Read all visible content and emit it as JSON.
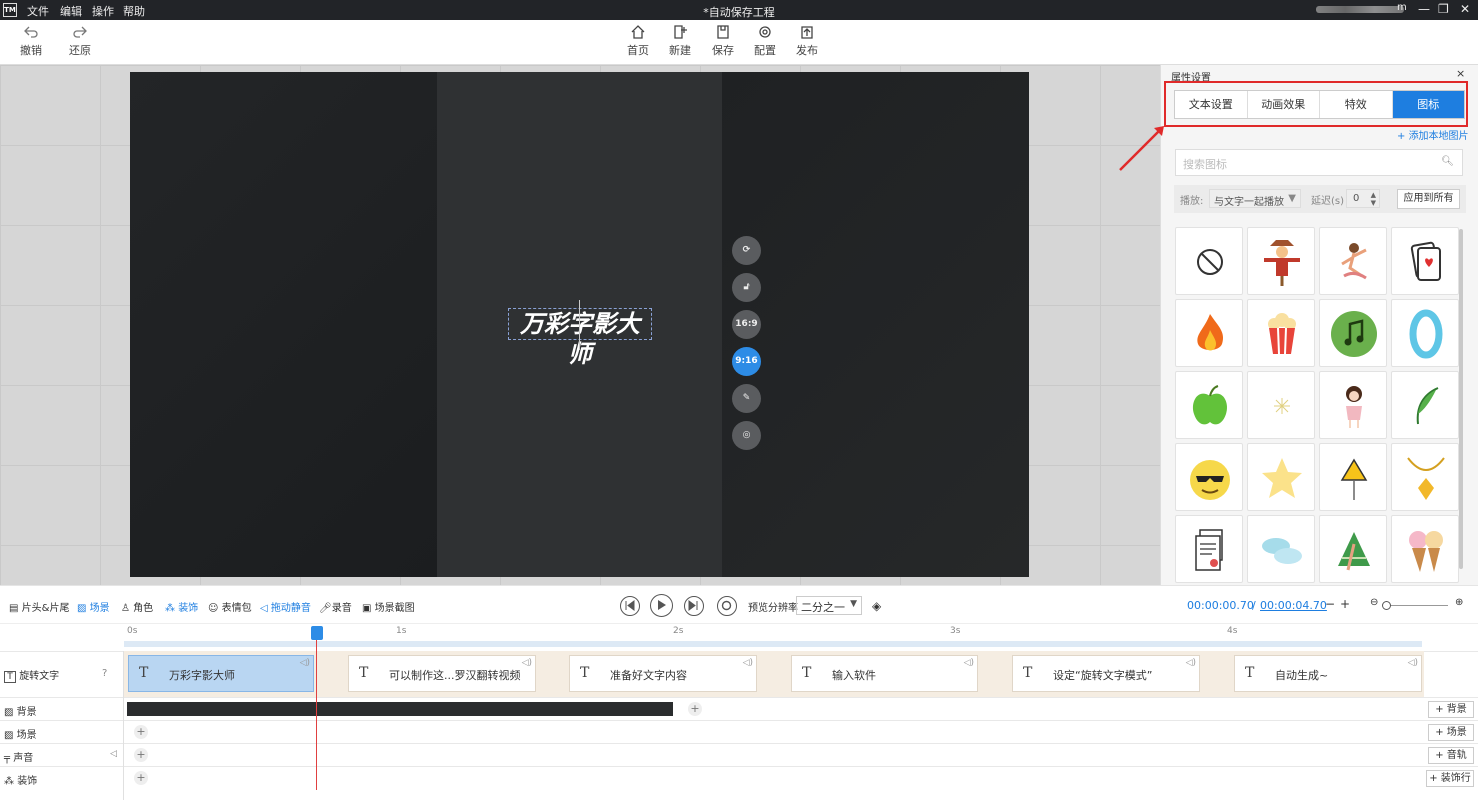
{
  "titlebar": {
    "logo": "TM",
    "menus": [
      "文件",
      "编辑",
      "操作",
      "帮助"
    ],
    "title": "*自动保存工程",
    "user": "m",
    "min": "—",
    "max": "❐",
    "close": "✕"
  },
  "toolbar": {
    "undo": "撤销",
    "redo": "还原",
    "home": "首页",
    "new": "新建",
    "save": "保存",
    "config": "配置",
    "publish": "发布"
  },
  "canvas": {
    "main_text": "万彩字影大师",
    "ratio_169": "16:9",
    "ratio_916": "9:16"
  },
  "panel": {
    "title": "属性设置",
    "close": "×",
    "tabs": [
      "文本设置",
      "动画效果",
      "特效",
      "图标"
    ],
    "active_tab": "图标",
    "add_local": "添加本地图片",
    "search_placeholder": "搜索图标",
    "play_label": "播放:",
    "play_value": "与文字一起播放",
    "delay_label": "延迟(s)",
    "delay_value": "0",
    "apply_all": "应用到所有",
    "icons": [
      "no-entry-icon",
      "scarecrow-icon",
      "dancing-girl-icon",
      "playing-cards-icon",
      "fire-icon",
      "popcorn-icon",
      "music-note-icon",
      "blue-ring-icon",
      "green-apple-icon",
      "sparkle-icon",
      "girl-figure-icon",
      "leaf-icon",
      "cool-emoji-icon",
      "star-icon",
      "warning-sign-icon",
      "necklace-icon",
      "document-icon",
      "macaron-icon",
      "zongzi-icon",
      "ice-cream-icon"
    ]
  },
  "controls": {
    "items": [
      "片头&片尾",
      "场景",
      "角色",
      "装饰",
      "表情包",
      "拖动静音",
      "录音",
      "场景截图"
    ],
    "preview_label": "预览分辨率",
    "preview_value": "二分之一",
    "time_current": "00:00:00.70",
    "time_sep": "/",
    "time_total": "00:00:04.70"
  },
  "ruler": {
    "ticks": [
      "0s",
      "1s",
      "2s",
      "3s",
      "4s"
    ]
  },
  "tracks": {
    "text": "旋转文字",
    "bg": "背景",
    "scene": "场景",
    "sound": "声音",
    "deco": "装饰",
    "add_bg": "+ 背景",
    "add_scene": "+ 场景",
    "add_sound": "+ 音轨",
    "add_deco": "+ 装饰行"
  },
  "clips": [
    "万彩字影大师",
    "可以制作这...罗汉翻转视频",
    "准备好文字内容",
    "输入软件",
    "设定“旋转文字模式”",
    "自动生成~"
  ]
}
